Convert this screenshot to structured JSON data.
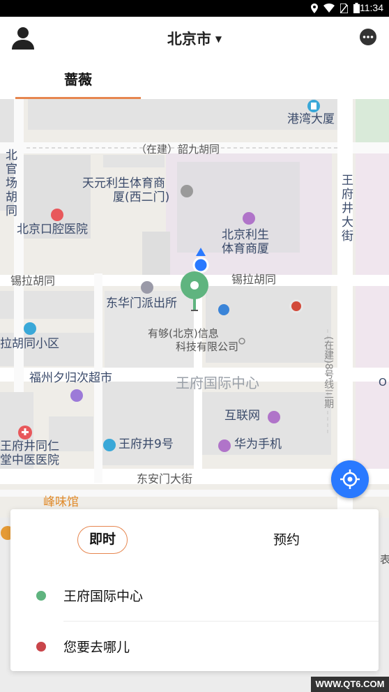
{
  "status_bar": {
    "time": "11:34"
  },
  "header": {
    "city": "北京市",
    "caret": "▼"
  },
  "tabs": [
    {
      "label": "蔷薇"
    }
  ],
  "map_labels": {
    "gangwan": "港湾大厦",
    "shaojiu": "（在建）韶九胡同",
    "beiguan1": "北",
    "beiguan2": "官",
    "beiguan3": "场",
    "beiguan4": "胡",
    "beiguan5": "同",
    "tianyuan1": "天元利生体育商",
    "tianyuan2": "厦(西二门)",
    "wangfujing1": "王",
    "wangfujing2": "府",
    "wangfujing3": "井",
    "wangfujing4": "大",
    "wangfujing5": "街",
    "kouqiang": "北京口腔医院",
    "lisheng1": "北京利生",
    "lisheng2": "体育商厦",
    "xila_west": "锡拉胡同",
    "xila_east": "锡拉胡同",
    "donghuamen": "东华门派出所",
    "yougou1": "有够(北京)信息",
    "yougou2": "科技有限公司",
    "xila_xiaoqu": "拉胡同小区",
    "zaijian": "(在建)8号线三期",
    "fuzhou": "福州夕归次超市",
    "wfj_center": "王府国际中心",
    "hulianwang": "互联网",
    "tongren1": "王府井同仁",
    "tongren2": "堂中医医院",
    "wfj9": "王府井9号",
    "huawei": "华为手机",
    "dongan": "东安门大街",
    "fengweiguan": "峰味馆",
    "edge_o": "O",
    "edge_biao": "表"
  },
  "card": {
    "mode_now": "即时",
    "mode_later": "预约",
    "origin": "王府国际中心",
    "destination": "您要去哪儿"
  },
  "colors": {
    "accent": "#e6864f",
    "origin_dot": "#5fb47f",
    "dest_dot": "#c9454a",
    "locate": "#2979ff"
  },
  "watermark": "WWW.QT6.COM"
}
